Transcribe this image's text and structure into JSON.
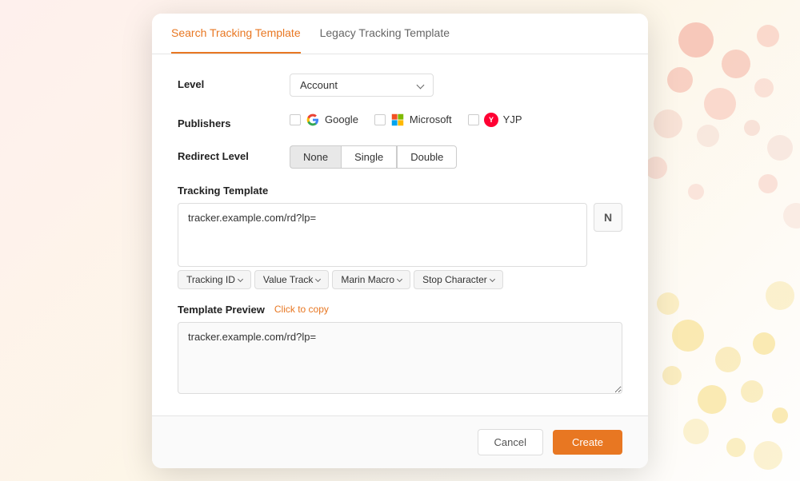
{
  "background": {
    "color": "#f5f0ee"
  },
  "tabs": {
    "items": [
      {
        "label": "Search Tracking Template",
        "active": true
      },
      {
        "label": "Legacy Tracking Template",
        "active": false
      }
    ]
  },
  "form": {
    "level_label": "Level",
    "level_value": "Account",
    "publishers_label": "Publishers",
    "publishers": [
      {
        "name": "Google",
        "checked": false
      },
      {
        "name": "Microsoft",
        "checked": false
      },
      {
        "name": "YJP",
        "checked": false
      }
    ],
    "redirect_label": "Redirect Level",
    "redirect_options": [
      {
        "label": "None",
        "active": true
      },
      {
        "label": "Single",
        "active": false
      },
      {
        "label": "Double",
        "active": false
      }
    ],
    "tracking_template_label": "Tracking Template",
    "tracking_template_value": "tracker.example.com/rd?lp=",
    "n_button_label": "N",
    "tag_buttons": [
      {
        "label": "Tracking ID"
      },
      {
        "label": "Value Track"
      },
      {
        "label": "Marin Macro"
      },
      {
        "label": "Stop Character"
      }
    ],
    "preview_title": "Template Preview",
    "click_to_copy": "Click to copy",
    "preview_value": "tracker.example.com/rd?lp="
  },
  "footer": {
    "cancel_label": "Cancel",
    "create_label": "Create"
  }
}
